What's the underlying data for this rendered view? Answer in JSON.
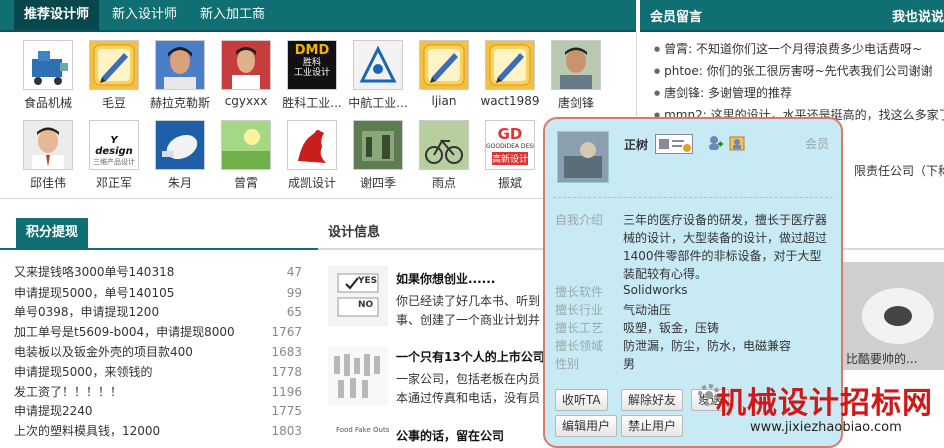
{
  "tabs": [
    {
      "label": "推荐设计师"
    },
    {
      "label": "新入设计师"
    },
    {
      "label": "新入加工商"
    }
  ],
  "messages_section": {
    "title": "会员留言",
    "title2": "我也说说"
  },
  "users": [
    {
      "name": "食品机械"
    },
    {
      "name": "毛豆"
    },
    {
      "name": "赫拉克勒斯"
    },
    {
      "name": "cgyxxx"
    },
    {
      "name": "胜科工业..."
    },
    {
      "name": "中航工业..."
    },
    {
      "name": "ljian"
    },
    {
      "name": "wact1989"
    },
    {
      "name": "唐剑锋"
    },
    {
      "name": "邱佳伟"
    },
    {
      "name": "邓正军"
    },
    {
      "name": "朱月"
    },
    {
      "name": "曾霄"
    },
    {
      "name": "成凯设计"
    },
    {
      "name": "谢四季"
    },
    {
      "name": "雨点"
    },
    {
      "name": "振斌"
    }
  ],
  "avatar_texts": {
    "dmd": "DMD",
    "dmd_sub": "胜科",
    "dmd_sub2": "工业设计",
    "design": "Y design",
    "design_sub": "三维产品设计",
    "gd": "GD",
    "gd_sub": "GOODIDEA DESIGN",
    "gd_sub2": "高新设计"
  },
  "messages": [
    {
      "text": "曾霄: 不知道你们这一个月得浪费多少电话费呀~"
    },
    {
      "text": "phtoe: 你们的张工很厉害呀~先代表我们公司谢谢"
    },
    {
      "text": "唐剑锋: 多谢管理的推荐"
    },
    {
      "text": "mmn2: 这里的设计，水平还是挺高的，找这么多家了"
    }
  ],
  "msg_partial": {
    "line1": "限责任公司（下称"
  },
  "points_section": {
    "title": "积分提现"
  },
  "points": [
    {
      "text": "又来提钱咯3000单号140318",
      "count": "47"
    },
    {
      "text": "申请提现5000，单号140105",
      "count": "99"
    },
    {
      "text": "单号0398，申请提现1200",
      "count": "65"
    },
    {
      "text": "加工单号是t5609-b004，申请提现8000",
      "count": "1767"
    },
    {
      "text": "电装板以及钣金外壳的项目款400",
      "count": "1683"
    },
    {
      "text": "申请提现5000，来领钱的",
      "count": "1778"
    },
    {
      "text": "发工资了！！！！！",
      "count": "1196"
    },
    {
      "text": "申请提现2240",
      "count": "1775"
    },
    {
      "text": "上次的塑料模具钱，12000",
      "count": "1803"
    }
  ],
  "design_section": {
    "title": "设计信息"
  },
  "news": [
    {
      "title": "如果你想创业......",
      "line1": "你已经读了好几本书、听到",
      "line2": "事、创建了一个商业计划并"
    },
    {
      "title": "一个只有13个人的上市公司",
      "line1": "一家公司，包括老板在内员",
      "line2": "本通过传真和电话，没有员"
    },
    {
      "title": "公事的话，留在公司"
    }
  ],
  "news_thumb_labels": {
    "yes": "YES",
    "no": "NO",
    "food": "Food Fake Outs"
  },
  "right_caption": "比酷要帅的...",
  "popup": {
    "name": "正树",
    "member": "会员",
    "intro_label": "自我介绍",
    "intro_lines": [
      "三年的医疗设备的研发，擅长于医疗器",
      "械的设计，大型装备的设计，做过超过",
      "1400件零部件的非标设备，对于大型",
      "装配较有心得。"
    ],
    "fields": [
      {
        "label": "擅长软件",
        "value": "Solidworks"
      },
      {
        "label": "擅长行业",
        "value": "气动油压"
      },
      {
        "label": "擅长工艺",
        "value": "吸塑，钣金，压铸"
      },
      {
        "label": "擅长领域",
        "value": "防泄漏，防尘，防水，电磁兼容"
      },
      {
        "label": "性别",
        "value": "男"
      }
    ],
    "buttons": [
      {
        "label": "收听TA"
      },
      {
        "label": "解除好友"
      },
      {
        "label": "发送"
      }
    ],
    "buttons2": [
      {
        "label": "编辑用户"
      },
      {
        "label": "禁止用户"
      }
    ]
  },
  "watermark": {
    "title": "机械设计招标网",
    "url": "www.jixiezhaobiao.com"
  },
  "colors": {
    "accent": "#0f6f73",
    "popup_bg": "#c8eaf4",
    "popup_border": "#d97b6b",
    "watermark": "#d01818"
  }
}
